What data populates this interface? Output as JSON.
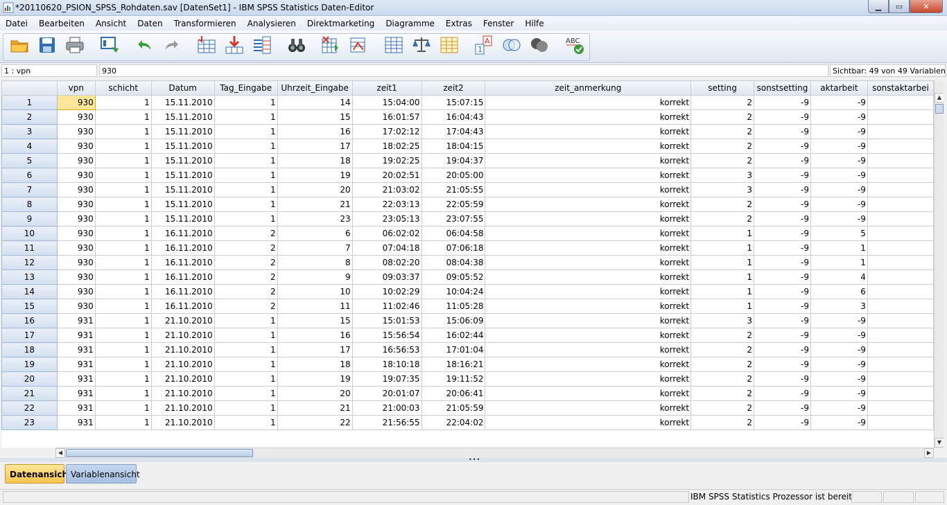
{
  "window": {
    "title": "*20110620_PSION_SPSS_Rohdaten.sav [DatenSet1] - IBM SPSS Statistics Daten-Editor",
    "minimize": "▁",
    "maximize": "▭",
    "close": "✕"
  },
  "menu": [
    "Datei",
    "Bearbeiten",
    "Ansicht",
    "Daten",
    "Transformieren",
    "Analysieren",
    "Direktmarketing",
    "Diagramme",
    "Extras",
    "Fenster",
    "Hilfe"
  ],
  "toolbar": {
    "icons": [
      "open-folder-icon",
      "save-icon",
      "print-icon",
      "dialog-recall-icon",
      "undo-icon",
      "redo-icon",
      "goto-case-icon",
      "goto-variable-icon",
      "variables-icon",
      "find-icon",
      "insert-cases-icon",
      "insert-variable-icon",
      "split-file-icon",
      "weight-cases-icon",
      "select-cases-icon",
      "value-labels-icon",
      "use-sets-icon",
      "show-all-variables-icon",
      "spell-check-icon"
    ],
    "colors": {
      "folder": "#f5a623",
      "save": "#2f6fb5",
      "accent_red": "#d9362b",
      "accent_green": "#3a9b3a"
    }
  },
  "editbar": {
    "cell_ref": "1 : vpn",
    "cell_value": "930",
    "visible_vars": "Sichtbar: 49 von 49 Variablen"
  },
  "columns": [
    "vpn",
    "schicht",
    "Datum",
    "Tag_Eingabe",
    "Uhrzeit_Eingabe",
    "zeit1",
    "zeit2",
    "zeit_anmerkung",
    "setting",
    "sonstsetting",
    "aktarbeit",
    "sonstaktarbei"
  ],
  "rows": [
    [
      "1",
      "930",
      "1",
      "15.11.2010",
      "1",
      "14",
      "15:04:00",
      "15:07:15",
      "korrekt",
      "2",
      "-9",
      "-9",
      ""
    ],
    [
      "2",
      "930",
      "1",
      "15.11.2010",
      "1",
      "15",
      "16:01:57",
      "16:04:43",
      "korrekt",
      "2",
      "-9",
      "-9",
      ""
    ],
    [
      "3",
      "930",
      "1",
      "15.11.2010",
      "1",
      "16",
      "17:02:12",
      "17:04:43",
      "korrekt",
      "2",
      "-9",
      "-9",
      ""
    ],
    [
      "4",
      "930",
      "1",
      "15.11.2010",
      "1",
      "17",
      "18:02:25",
      "18:04:15",
      "korrekt",
      "2",
      "-9",
      "-9",
      ""
    ],
    [
      "5",
      "930",
      "1",
      "15.11.2010",
      "1",
      "18",
      "19:02:25",
      "19:04:37",
      "korrekt",
      "2",
      "-9",
      "-9",
      ""
    ],
    [
      "6",
      "930",
      "1",
      "15.11.2010",
      "1",
      "19",
      "20:02:51",
      "20:05:00",
      "korrekt",
      "3",
      "-9",
      "-9",
      ""
    ],
    [
      "7",
      "930",
      "1",
      "15.11.2010",
      "1",
      "20",
      "21:03:02",
      "21:05:55",
      "korrekt",
      "3",
      "-9",
      "-9",
      ""
    ],
    [
      "8",
      "930",
      "1",
      "15.11.2010",
      "1",
      "21",
      "22:03:13",
      "22:05:59",
      "korrekt",
      "2",
      "-9",
      "-9",
      ""
    ],
    [
      "9",
      "930",
      "1",
      "15.11.2010",
      "1",
      "23",
      "23:05:13",
      "23:07:55",
      "korrekt",
      "2",
      "-9",
      "-9",
      ""
    ],
    [
      "10",
      "930",
      "1",
      "16.11.2010",
      "2",
      "6",
      "06:02:02",
      "06:04:58",
      "korrekt",
      "1",
      "-9",
      "5",
      ""
    ],
    [
      "11",
      "930",
      "1",
      "16.11.2010",
      "2",
      "7",
      "07:04:18",
      "07:06:18",
      "korrekt",
      "1",
      "-9",
      "1",
      ""
    ],
    [
      "12",
      "930",
      "1",
      "16.11.2010",
      "2",
      "8",
      "08:02:20",
      "08:04:38",
      "korrekt",
      "1",
      "-9",
      "1",
      ""
    ],
    [
      "13",
      "930",
      "1",
      "16.11.2010",
      "2",
      "9",
      "09:03:37",
      "09:05:52",
      "korrekt",
      "1",
      "-9",
      "4",
      ""
    ],
    [
      "14",
      "930",
      "1",
      "16.11.2010",
      "2",
      "10",
      "10:02:29",
      "10:04:24",
      "korrekt",
      "1",
      "-9",
      "6",
      ""
    ],
    [
      "15",
      "930",
      "1",
      "16.11.2010",
      "2",
      "11",
      "11:02:46",
      "11:05:28",
      "korrekt",
      "1",
      "-9",
      "3",
      ""
    ],
    [
      "16",
      "931",
      "1",
      "21.10.2010",
      "1",
      "15",
      "15:01:53",
      "15:06:09",
      "korrekt",
      "3",
      "-9",
      "-9",
      ""
    ],
    [
      "17",
      "931",
      "1",
      "21.10.2010",
      "1",
      "16",
      "15:56:54",
      "16:02:44",
      "korrekt",
      "2",
      "-9",
      "-9",
      ""
    ],
    [
      "18",
      "931",
      "1",
      "21.10.2010",
      "1",
      "17",
      "16:56:53",
      "17:01:04",
      "korrekt",
      "2",
      "-9",
      "-9",
      ""
    ],
    [
      "19",
      "931",
      "1",
      "21.10.2010",
      "1",
      "18",
      "18:10:18",
      "18:16:21",
      "korrekt",
      "2",
      "-9",
      "-9",
      ""
    ],
    [
      "20",
      "931",
      "1",
      "21.10.2010",
      "1",
      "19",
      "19:07:35",
      "19:11:52",
      "korrekt",
      "2",
      "-9",
      "-9",
      ""
    ],
    [
      "21",
      "931",
      "1",
      "21.10.2010",
      "1",
      "20",
      "20:01:07",
      "20:06:41",
      "korrekt",
      "2",
      "-9",
      "-9",
      ""
    ],
    [
      "22",
      "931",
      "1",
      "21.10.2010",
      "1",
      "21",
      "21:00:03",
      "21:05:59",
      "korrekt",
      "2",
      "-9",
      "-9",
      ""
    ],
    [
      "23",
      "931",
      "1",
      "21.10.2010",
      "1",
      "22",
      "21:56:55",
      "22:04:02",
      "korrekt",
      "2",
      "-9",
      "-9",
      ""
    ]
  ],
  "tabs": {
    "data_view": "Datenansicht",
    "variable_view": "Variablenansicht"
  },
  "status": {
    "processor": "IBM SPSS Statistics  Prozessor ist bereit"
  }
}
